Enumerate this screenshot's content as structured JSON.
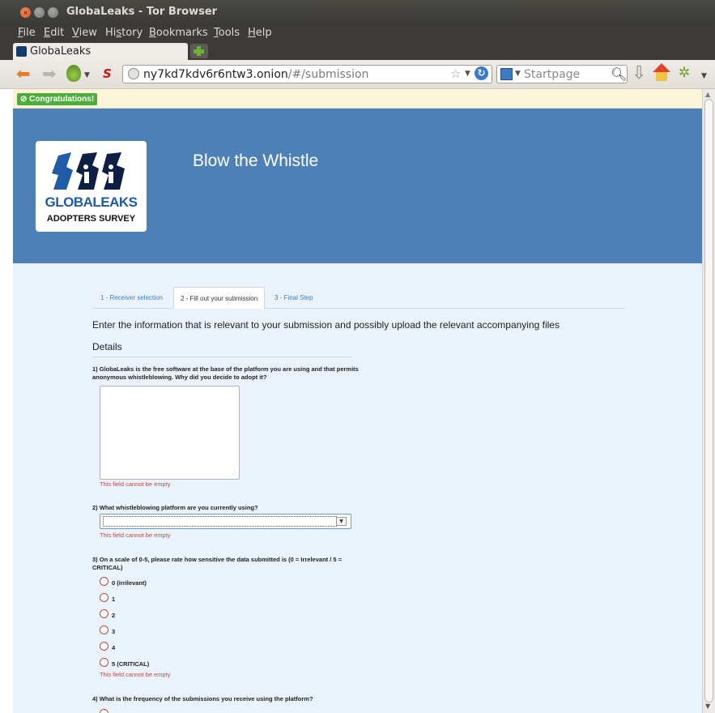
{
  "window": {
    "title": "GlobaLeaks - Tor Browser"
  },
  "menubar": [
    {
      "first": "F",
      "rest": "ile"
    },
    {
      "first": "E",
      "rest": "dit"
    },
    {
      "first": "V",
      "rest": "iew"
    },
    {
      "first": "Hi",
      "ul": "s",
      "rest": "tory"
    },
    {
      "first": "B",
      "rest": "ookmarks"
    },
    {
      "first": "T",
      "rest": "ools"
    },
    {
      "first": "H",
      "rest": "elp"
    }
  ],
  "tab": {
    "label": "GlobaLeaks"
  },
  "urlbar": {
    "host": "ny7kd7kdv6r6ntw3.onion",
    "path": "/#/submission"
  },
  "searchbar": {
    "placeholder": "Startpage"
  },
  "notification": {
    "badge": "⊘ Congratulations!"
  },
  "hero": {
    "logo_word": "GLOBALEAKS",
    "logo_sub": "ADOPTERS SURVEY",
    "title": "Blow the Whistle"
  },
  "steps": [
    "1 - Receiver selection",
    "2 - Fill out your submission",
    "3 - Final Step"
  ],
  "form": {
    "intro": "Enter the information that is relevant to your submission and possibly upload the relevant accompanying files",
    "section": "Details",
    "q1": "1) GlobaLeaks is the free software at the base of the platform you are using and that permits anonymous whistleblowing. Why did you decide to adopt it?",
    "q2": "2) What whistleblowing platform are you currently using?",
    "q3": "3) On a scale of 0-5, please rate how sensitive the data submitted is (0 = Irrelevant / 5 = CRITICAL)",
    "q3_options": [
      "0 (irrilevant)",
      "1",
      "2",
      "3",
      "4",
      "5 (CRITICAL)"
    ],
    "q4": "4) What is the frequency of the submissions you receive using the platform?",
    "error": "This field cannot be empty"
  }
}
